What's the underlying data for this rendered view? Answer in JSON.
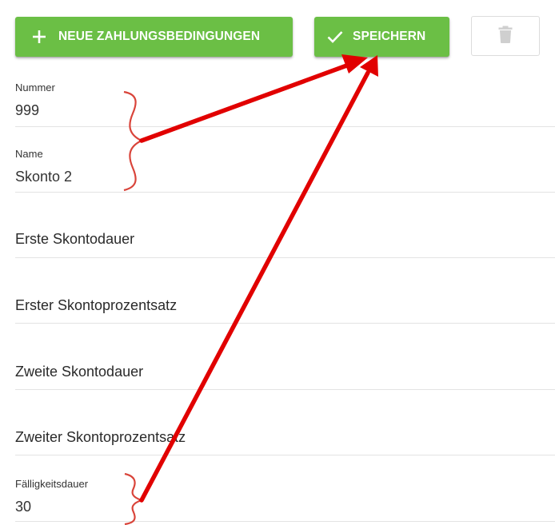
{
  "toolbar": {
    "new_label": "NEUE ZAHLUNGSBEDINGUNGEN",
    "save_label": "SPEICHERN",
    "accent_color": "#6bbf45",
    "new_icon": "plus-icon",
    "save_icon": "check-icon",
    "delete_icon": "trash-icon"
  },
  "form": {
    "nummer": {
      "label": "Nummer",
      "value": "999"
    },
    "name": {
      "label": "Name",
      "value": "Skonto 2"
    },
    "erste_skontodauer": {
      "label": "Erste Skontodauer"
    },
    "erster_skontoprozentsatz": {
      "label": "Erster Skontoprozentsatz"
    },
    "zweite_skontodauer": {
      "label": "Zweite Skontodauer"
    },
    "zweiter_skontoprozentsatz": {
      "label": "Zweiter Skontoprozentsatz"
    },
    "faelligkeitsdauer": {
      "label": "Fälligkeitsdauer",
      "value": "30"
    }
  },
  "annotation": {
    "arrow_color": "#e10000",
    "brace_color": "#d9443a"
  }
}
